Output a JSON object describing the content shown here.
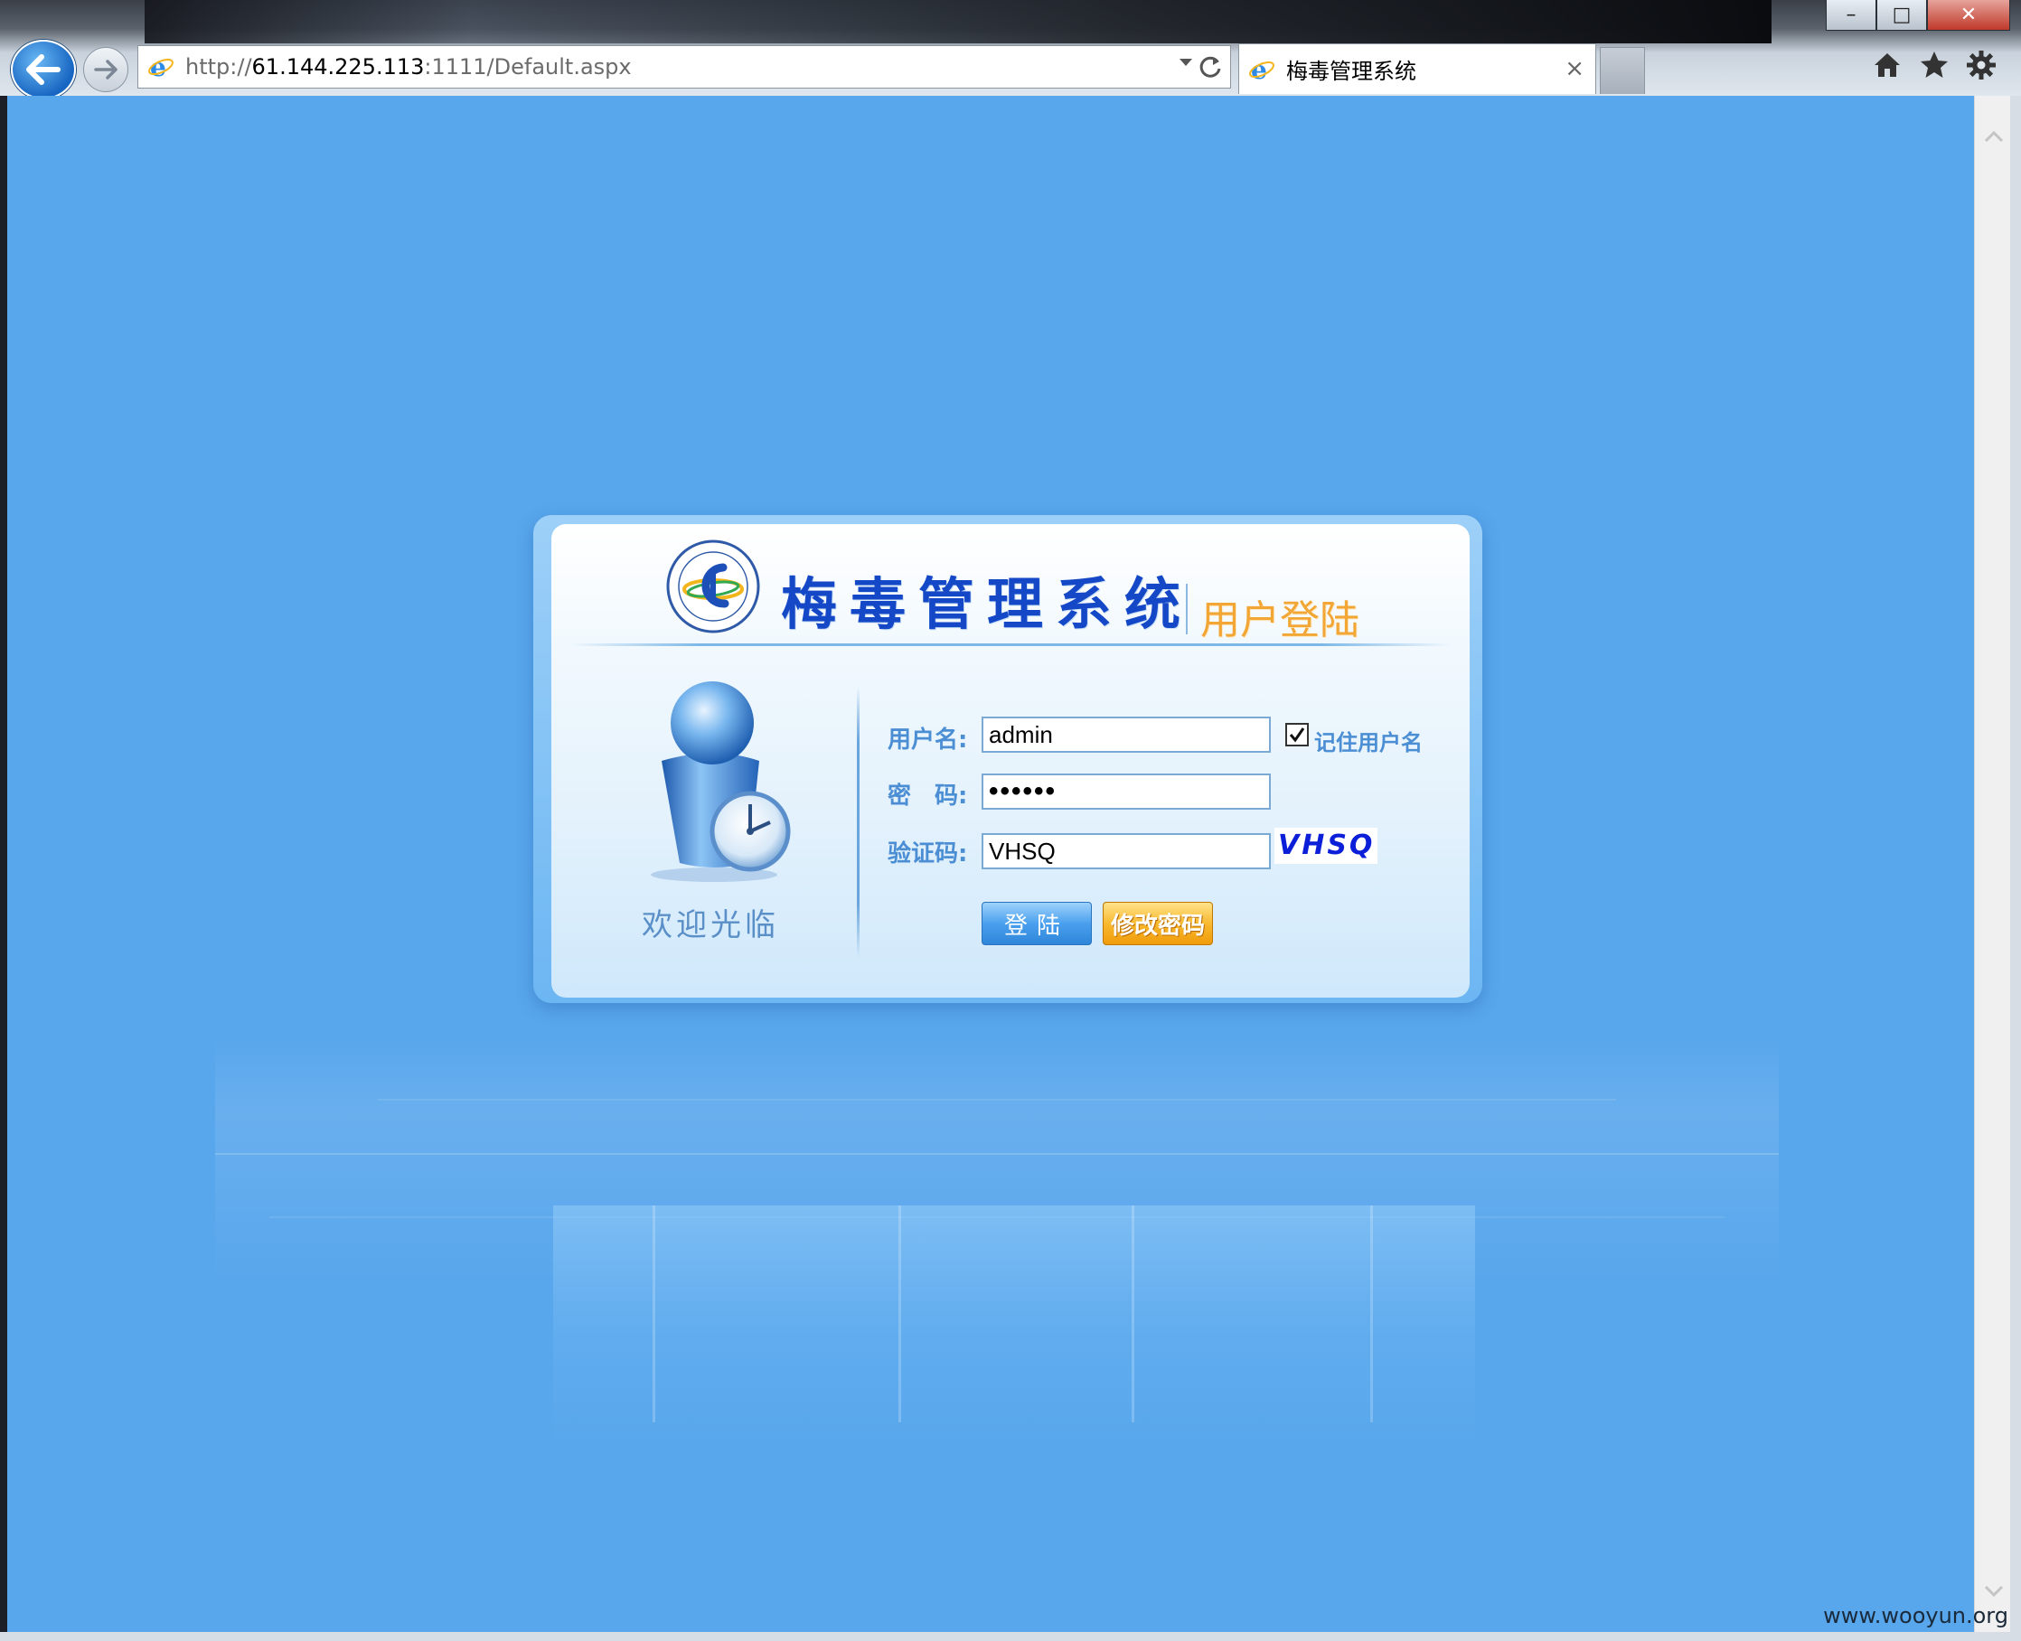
{
  "browser": {
    "url": "http://61.144.225.113:1111/Default.aspx",
    "url_prefix": "http://",
    "url_host": "61.144.225.113",
    "url_rest": ":1111/Default.aspx",
    "tab_title": "梅毒管理系统",
    "tab_close": "×",
    "window_controls": {
      "minimize": "–",
      "maximize": "□",
      "close": "✕"
    },
    "icons": [
      "back-icon",
      "forward-icon",
      "ie-icon",
      "refresh-icon",
      "home-icon",
      "favorites-star-icon",
      "settings-gear-icon"
    ]
  },
  "login": {
    "title": "梅毒管理系统",
    "subtitle": "用户登陆",
    "welcome": "欢迎光临",
    "username_label": "用户名:",
    "username_value": "admin",
    "remember_label": "记住用户名",
    "remember_checked": true,
    "password_label": "密　码:",
    "password_value": "••••••",
    "captcha_label": "验证码:",
    "captcha_value": "VHSQ",
    "captcha_image_text": "VHSQ",
    "login_button": "登陆",
    "change_password_button": "修改密码"
  },
  "watermark": "www.wooyun.org",
  "colors": {
    "background": "#58a6ec",
    "title": "#1448c7",
    "subtitle": "#f2a635",
    "label": "#4c8ed4",
    "captcha": "#0b1fd8"
  }
}
